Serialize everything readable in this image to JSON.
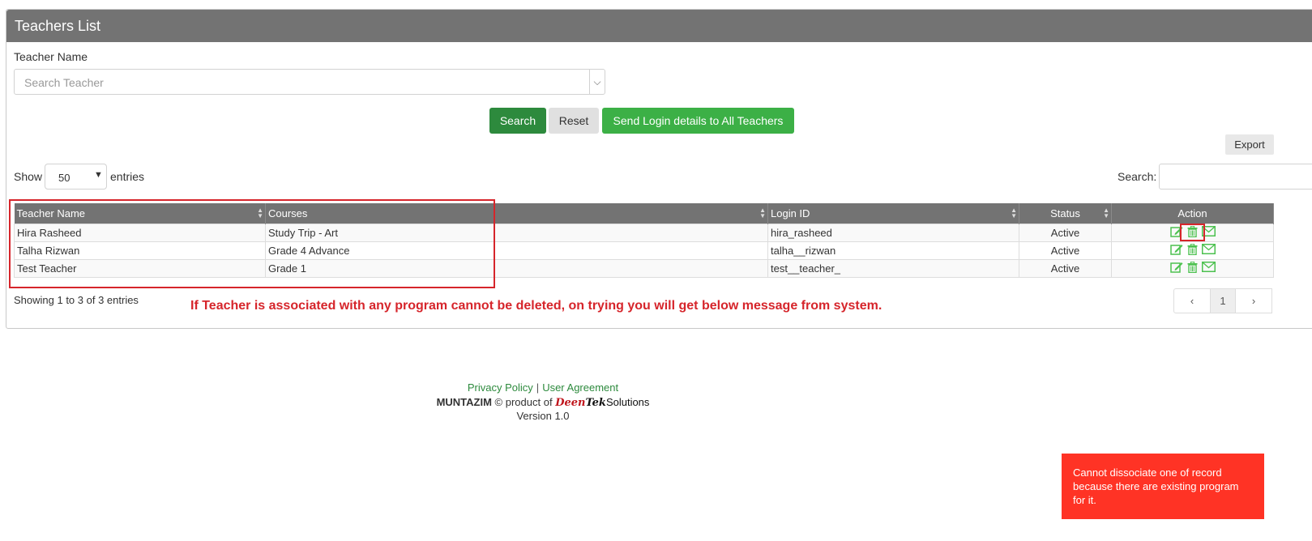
{
  "panel": {
    "title": "Teachers List"
  },
  "filter": {
    "label": "Teacher Name",
    "placeholder": "Search Teacher",
    "arrow": "⌵"
  },
  "buttons": {
    "search": "Search",
    "reset": "Reset",
    "send_login": "Send Login details to All Teachers",
    "export": "Export"
  },
  "length_menu": {
    "show": "Show",
    "value": "50",
    "entries": "entries"
  },
  "table_search": {
    "label": "Search:"
  },
  "table": {
    "headers": [
      "Teacher Name",
      "Courses",
      "Login ID",
      "Status",
      "Action"
    ],
    "rows": [
      {
        "name": "Hira Rasheed",
        "course": "Study Trip - Art",
        "login": "hira_rasheed",
        "status": "Active"
      },
      {
        "name": "Talha Rizwan",
        "course": "Grade 4 Advance",
        "login": "talha__rizwan",
        "status": "Active"
      },
      {
        "name": "Test Teacher",
        "course": "Grade 1",
        "login": "test__teacher_",
        "status": "Active"
      }
    ],
    "action_icons": [
      "edit-icon",
      "trash-icon",
      "mail-icon"
    ]
  },
  "table_info": "Showing 1 to 3 of 3 entries",
  "annotation": "If Teacher is associated with any program cannot be deleted, on trying you will get below message from system.",
  "pagination": {
    "prev": "‹",
    "page": "1",
    "next": "›"
  },
  "footer": {
    "privacy": "Privacy Policy",
    "separator": "|",
    "agreement": "User Agreement",
    "brand": "MUNTAZIM",
    "product_of": "© product of",
    "logo_deen": "Deen",
    "logo_tek": "Tek",
    "logo_solutions": "Solutions",
    "version": "Version 1.0"
  },
  "toast": "Cannot dissociate one of record because there are existing program for it.",
  "colors": {
    "header_gray": "#737373",
    "primary_green": "#2d8a3d",
    "bright_green": "#3cb046",
    "alert_red": "#d6252b",
    "toast_red": "#ff3325",
    "icon_green": "#4cc14f"
  }
}
